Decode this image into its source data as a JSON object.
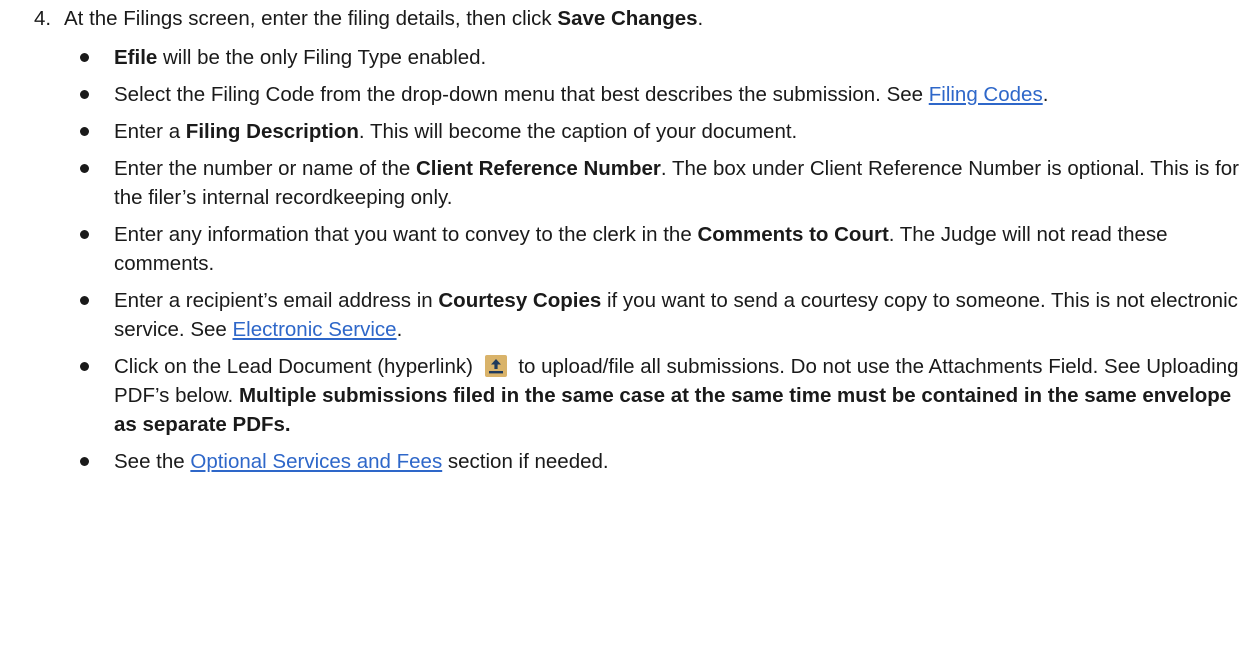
{
  "step": {
    "number": "4.",
    "intro": "At the Filings screen, enter the filing details, then click ",
    "intro_bold": "Save Changes",
    "intro_end": "."
  },
  "bullets": [
    {
      "b1": "Efile",
      "t1": " will be the only Filing Type enabled."
    },
    {
      "t1": "Select the Filing Code from the drop-down menu that best describes the submission. See ",
      "link": "Filing Codes",
      "t2": "."
    },
    {
      "t1": "Enter a ",
      "b1": "Filing Description",
      "t2": ". This will become the caption of your document."
    },
    {
      "t1": "Enter the number or name of the ",
      "b1": "Client Reference Number",
      "t2": ". The box under Client Reference Number is optional. This is for the filer’s internal recordkeeping only."
    },
    {
      "t1": "Enter any information that you want to convey to the clerk in the ",
      "b1": "Comments to Court",
      "t2": ". The Judge will not read these comments."
    },
    {
      "t1": "Enter a recipient’s email address in ",
      "b1": "Courtesy Copies",
      "t2": " if you want to send a courtesy copy to someone. This is not electronic service. See ",
      "link": "Electronic Service",
      "t3": "."
    },
    {
      "t1": "Click on the Lead Document (hyperlink) ",
      "icon": "upload-icon",
      "t2": " to upload/file all submissions. Do not use the Attachments Field. See Uploading PDF’s below. ",
      "b1": "Multiple submissions filed in the same case at the same time must be contained in the same envelope as separate PDFs."
    },
    {
      "t1": "See the ",
      "link": "Optional Services and Fees",
      "t2": " section if needed."
    }
  ],
  "colors": {
    "link": "#2e67c9",
    "icon_bg": "#d9b36a",
    "icon_fg": "#1f3a5c"
  }
}
